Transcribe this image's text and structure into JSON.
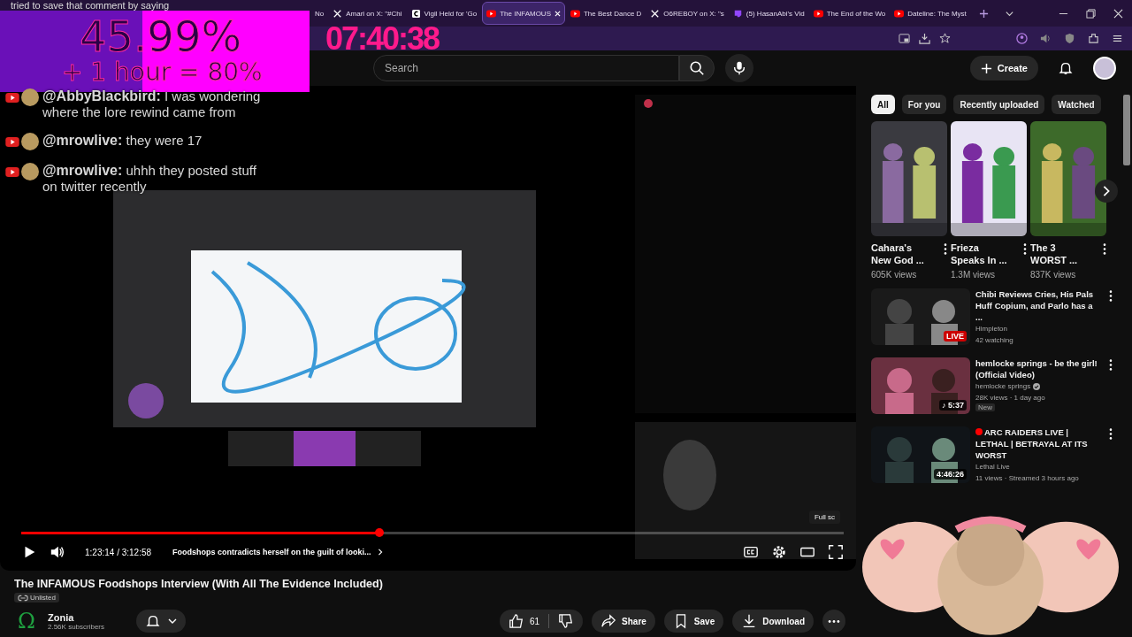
{
  "stream_overlay": {
    "caption": "tried to save that comment by saying",
    "goal": {
      "percent": "45.99%",
      "bonus": "+ 1 hour = 80%",
      "level": 0.4599
    },
    "timer": "07:40:38",
    "chat": [
      {
        "name": "@AbbyBlackbird:",
        "text": "I was wondering where the lore rewind came from"
      },
      {
        "name": "@mrowlive:",
        "text": "they were 17"
      },
      {
        "name": "@mrowlive:",
        "text": "uhhh they posted stuff on twitter recently"
      }
    ]
  },
  "browser": {
    "tabs": [
      {
        "title": "No",
        "kind": "site",
        "selected": false
      },
      {
        "title": "Amari on X: \"#Chi",
        "kind": "x",
        "selected": false
      },
      {
        "title": "Vigil Held for 'Go",
        "kind": "letter",
        "selected": false
      },
      {
        "title": "The INFAMOUS",
        "kind": "youtube",
        "selected": true
      },
      {
        "title": "The Best Dance D",
        "kind": "youtube",
        "selected": false
      },
      {
        "title": "O6REBOY on X: \"s",
        "kind": "x",
        "selected": false
      },
      {
        "title": "(5) HasanAbi's Vid",
        "kind": "twitch",
        "selected": false
      },
      {
        "title": "The End of the Wo",
        "kind": "youtube",
        "selected": false
      },
      {
        "title": "Dateline: The Myst",
        "kind": "youtube",
        "selected": false
      }
    ]
  },
  "header": {
    "search": {
      "placeholder": "Search"
    },
    "create": "Create"
  },
  "player": {
    "progress": {
      "level": 0.436
    },
    "time": "1:23:14 / 3:12:58",
    "chapter": "Foodshops contradicts herself on the guilt of looki...",
    "tooltip": "Full sc"
  },
  "video": {
    "title": "The INFAMOUS Foodshops Interview (With All The Evidence Included)",
    "visibility": "Unlisted",
    "channel": {
      "avatar": "Ω",
      "name": "Zonia",
      "subscribers": "2.56K subscribers"
    },
    "likes": "61",
    "actions": [
      "Share",
      "Save",
      "Download"
    ]
  },
  "sidebar": {
    "chips": [
      {
        "label": "All",
        "selected": true
      },
      {
        "label": "For you",
        "selected": false
      },
      {
        "label": "Recently uploaded",
        "selected": false
      },
      {
        "label": "Watched",
        "selected": false
      }
    ],
    "shorts": [
      {
        "title": "Cahara's New God ...",
        "views": "605K views"
      },
      {
        "title": "Frieza Speaks In ...",
        "views": "1.3M views"
      },
      {
        "title": "The 3 WORST ...",
        "views": "837K views"
      }
    ],
    "videos": [
      {
        "title": "Chibi Reviews Cries, His Pals Huff Copium, and Parlo has a ...",
        "channel": "Himpleton",
        "verified": false,
        "meta": "42 watching",
        "badge": "LIVE",
        "kind": "live",
        "new": false
      },
      {
        "title": "hemlocke springs - be the girl! (Official Video)",
        "channel": "hemlocke springs",
        "verified": true,
        "meta": "28K views · 1 day ago",
        "badge": "♪ 5:37",
        "kind": "music",
        "new": true,
        "new_label": "New"
      },
      {
        "title": "ARC RAIDERS LIVE | LETHAL | BETRAYAL AT ITS WORST",
        "channel": "Lethal Live",
        "verified": false,
        "meta": "11 views · Streamed 3 hours ago",
        "badge": "4:46:26",
        "kind": "duration",
        "new": false,
        "live_dot": true
      }
    ]
  }
}
